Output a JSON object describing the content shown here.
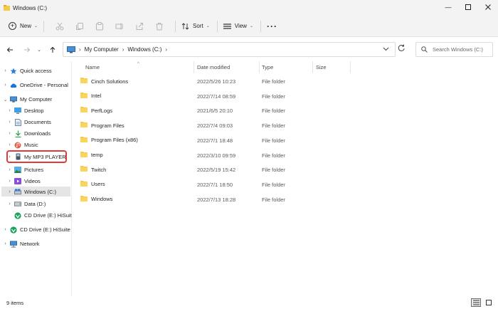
{
  "window": {
    "title": "Windows (C:)"
  },
  "toolbar": {
    "new_label": "New",
    "sort_label": "Sort",
    "view_label": "View"
  },
  "address": {
    "root": "My Computer",
    "current": "Windows (C:)"
  },
  "search": {
    "placeholder": "Search Windows (C:)"
  },
  "nav": {
    "quick_access": "Quick access",
    "onedrive": "OneDrive - Personal",
    "my_computer": "My Computer",
    "desktop": "Desktop",
    "documents": "Documents",
    "downloads": "Downloads",
    "music": "Music",
    "mp3_player": "My MP3 PLAYER",
    "pictures": "Pictures",
    "videos": "Videos",
    "windows_c": "Windows (C:)",
    "data_d": "Data (D:)",
    "cd_drive_e_sub": "CD Drive (E:) HiSuit",
    "cd_drive_e": "CD Drive (E:) HiSuite",
    "network": "Network"
  },
  "columns": {
    "name": "Name",
    "date_modified": "Date modified",
    "type": "Type",
    "size": "Size"
  },
  "files": [
    {
      "name": "Cinch Solutions",
      "date": "2022/5/26 10:23",
      "type": "File folder"
    },
    {
      "name": "Intel",
      "date": "2022/7/14 08:59",
      "type": "File folder"
    },
    {
      "name": "PerfLogs",
      "date": "2021/6/5 20:10",
      "type": "File folder"
    },
    {
      "name": "Program Files",
      "date": "2022/7/4 09:03",
      "type": "File folder"
    },
    {
      "name": "Program Files (x86)",
      "date": "2022/7/1 18:48",
      "type": "File folder"
    },
    {
      "name": "temp",
      "date": "2022/3/10 09:59",
      "type": "File folder"
    },
    {
      "name": "Twitch",
      "date": "2022/5/19 15:42",
      "type": "File folder"
    },
    {
      "name": "Users",
      "date": "2022/7/1 18:50",
      "type": "File folder"
    },
    {
      "name": "Windows",
      "date": "2022/7/13 18:28",
      "type": "File folder"
    }
  ],
  "status": {
    "count": "9 items"
  },
  "colors": {
    "folder": "#f7c948",
    "highlight": "#e03c3c",
    "selected": "#e5e5e5"
  }
}
